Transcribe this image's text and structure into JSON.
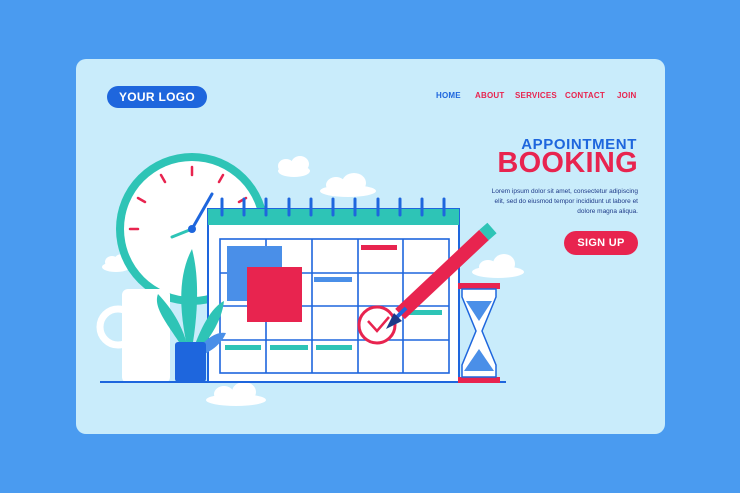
{
  "header": {
    "logo_label": "YOUR LOGO"
  },
  "nav": {
    "items": [
      "HOME",
      "ABOUT",
      "SERVICES",
      "CONTACT",
      "JOIN"
    ]
  },
  "hero": {
    "subtitle": "APPOINTMENT",
    "title": "BOOKING",
    "description": "Lorem ipsum dolor sit amet, consectetur adipiscing elit, sed do eiusmod tempor incididunt ut labore et dolore magna aliqua.",
    "cta_label": "SIGN UP"
  },
  "colors": {
    "background": "#4a9bf0",
    "card": "#c9ecfb",
    "brand_blue": "#1e66dd",
    "accent_red": "#e8244f",
    "teal": "#2ec4b6"
  },
  "icons": [
    "clock-icon",
    "calendar-icon",
    "pencil-icon",
    "hourglass-icon",
    "plant-icon",
    "mug-icon",
    "cloud-icon"
  ]
}
